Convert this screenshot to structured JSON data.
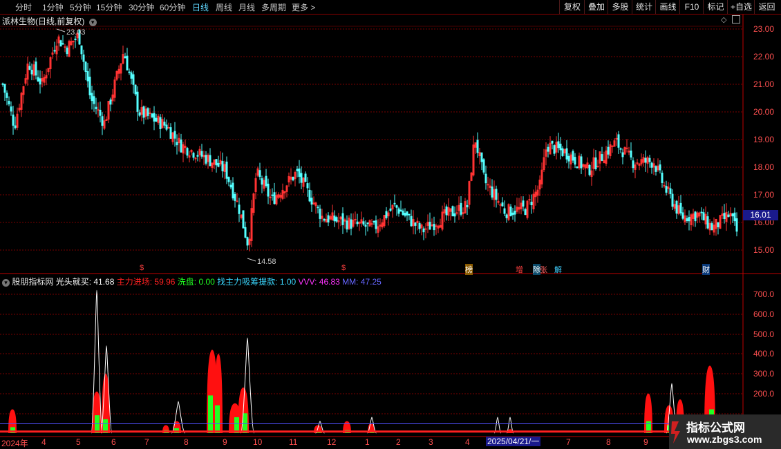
{
  "toolbar": {
    "periods": [
      "分时",
      "1分钟",
      "5分钟",
      "15分钟",
      "30分钟",
      "60分钟",
      "日线",
      "周线",
      "月线",
      "多周期",
      "更多 >"
    ],
    "active_period": "日线",
    "buttons": [
      "复权",
      "叠加",
      "多股",
      "统计",
      "画线",
      "F10",
      "标记",
      "+自选",
      "返回"
    ]
  },
  "main_chart": {
    "title": "派林生物(日线,前复权)",
    "y_ticks": [
      "23.00",
      "22.00",
      "21.00",
      "20.00",
      "19.00",
      "18.00",
      "17.00",
      "16.00",
      "15.00"
    ],
    "current_price": "16.01",
    "high_label": "23.03",
    "low_label": "14.58",
    "event_tags": [
      "$",
      "$",
      "榜",
      "增",
      "除",
      "张",
      "解",
      "财"
    ],
    "colors": {
      "up": "#ff3232",
      "down": "#54ffff",
      "grid": "#7a0000",
      "axis": "#c00000"
    }
  },
  "indicator": {
    "name": "股朋指标网",
    "items": [
      {
        "label": "光头就买: 41.68",
        "color": "#ffffff"
      },
      {
        "label": "主力进场: 59.96",
        "color": "#ff2020"
      },
      {
        "label": "洗盘: 0.00",
        "color": "#20ff20"
      },
      {
        "label": "找主力吸筹提款: 1.00",
        "color": "#3ad7ff"
      },
      {
        "label": "VVV: 46.83",
        "color": "#ff33ff"
      },
      {
        "label": "MM: 47.25",
        "color": "#6666ff"
      }
    ],
    "y_ticks": [
      "700.0",
      "600.0",
      "500.0",
      "400.0",
      "300.0",
      "200.0"
    ]
  },
  "x_axis": {
    "labels": [
      "2024年",
      "4",
      "5",
      "6",
      "7",
      "8",
      "9",
      "10",
      "11",
      "12",
      "1",
      "2",
      "3",
      "4",
      "2025/04/21/一",
      "7",
      "8",
      "9"
    ],
    "highlight": "2025/04/21/一"
  },
  "watermark": {
    "title": "指标公式网",
    "url": "www.zbgs3.com"
  }
}
